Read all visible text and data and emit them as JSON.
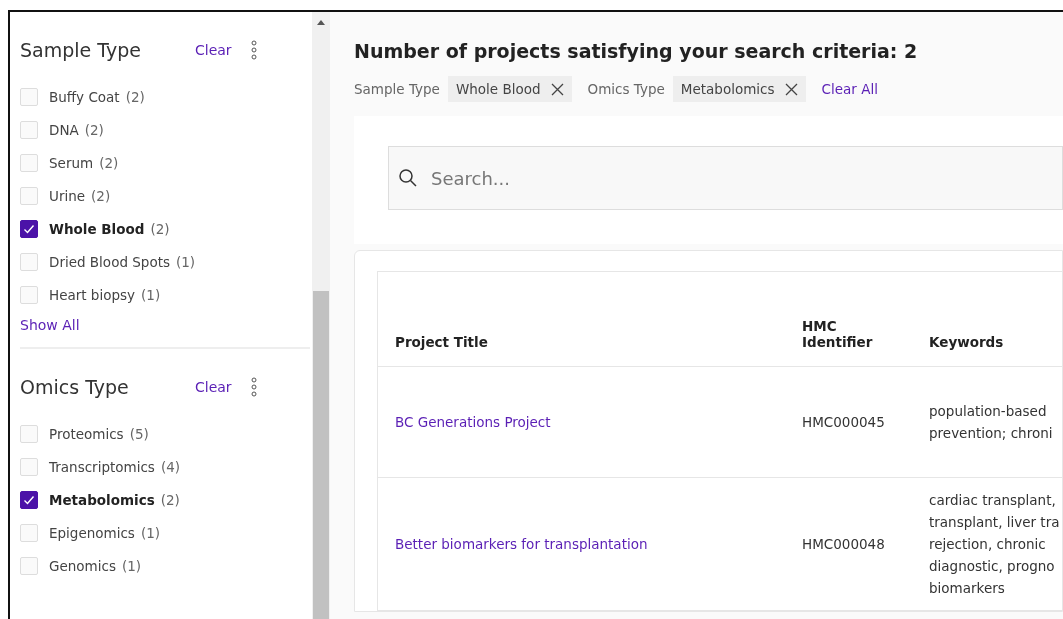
{
  "filters": [
    {
      "title": "Sample Type",
      "clear": "Clear",
      "options": [
        {
          "label": "Buffy Coat",
          "count": "(2)",
          "checked": false
        },
        {
          "label": "DNA",
          "count": "(2)",
          "checked": false
        },
        {
          "label": "Serum",
          "count": "(2)",
          "checked": false
        },
        {
          "label": "Urine",
          "count": "(2)",
          "checked": false
        },
        {
          "label": "Whole Blood",
          "count": "(2)",
          "checked": true
        },
        {
          "label": "Dried Blood Spots",
          "count": "(1)",
          "checked": false
        },
        {
          "label": "Heart biopsy",
          "count": "(1)",
          "checked": false
        }
      ],
      "show_all": "Show All"
    },
    {
      "title": "Omics Type",
      "clear": "Clear",
      "options": [
        {
          "label": "Proteomics",
          "count": "(5)",
          "checked": false
        },
        {
          "label": "Transcriptomics",
          "count": "(4)",
          "checked": false
        },
        {
          "label": "Metabolomics",
          "count": "(2)",
          "checked": true
        },
        {
          "label": "Epigenomics",
          "count": "(1)",
          "checked": false
        },
        {
          "label": "Genomics",
          "count": "(1)",
          "checked": false
        }
      ]
    }
  ],
  "heading": "Number of projects satisfying your search criteria: 2",
  "active_filters": [
    {
      "category": "Sample Type",
      "value": "Whole Blood"
    },
    {
      "category": "Omics Type",
      "value": "Metabolomics"
    }
  ],
  "clear_all": "Clear All",
  "search": {
    "placeholder": "Search..."
  },
  "table": {
    "columns": [
      "Project Title",
      "HMC Identifier",
      "Keywords"
    ],
    "rows": [
      {
        "title": "BC Generations Project",
        "id": "HMC000045",
        "keywords": [
          "population-based",
          "prevention; chroni"
        ]
      },
      {
        "title": "Better biomarkers for transplantation",
        "id": "HMC000048",
        "keywords": [
          "cardiac transplant,",
          "transplant, liver tra",
          "rejection, chronic",
          "diagnostic, progno",
          "biomarkers"
        ]
      }
    ]
  }
}
